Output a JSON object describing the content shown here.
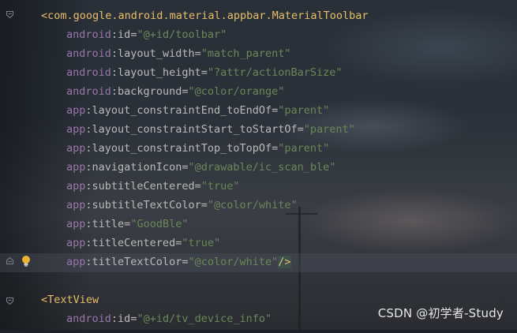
{
  "editor": {
    "lines": [
      {
        "type": "open",
        "tag": "com.google.android.material.appbar.MaterialToolbar"
      },
      {
        "type": "attr",
        "ns": "android",
        "name": "id",
        "value": "\"@+id/toolbar\""
      },
      {
        "type": "attr",
        "ns": "android",
        "name": "layout_width",
        "value": "\"match_parent\""
      },
      {
        "type": "attr",
        "ns": "android",
        "name": "layout_height",
        "value": "\"?attr/actionBarSize\""
      },
      {
        "type": "attr",
        "ns": "android",
        "name": "background",
        "value": "\"@color/orange\""
      },
      {
        "type": "attr",
        "ns": "app",
        "name": "layout_constraintEnd_toEndOf",
        "value": "\"parent\""
      },
      {
        "type": "attr",
        "ns": "app",
        "name": "layout_constraintStart_toStartOf",
        "value": "\"parent\""
      },
      {
        "type": "attr",
        "ns": "app",
        "name": "layout_constraintTop_toTopOf",
        "value": "\"parent\""
      },
      {
        "type": "attr",
        "ns": "app",
        "name": "navigationIcon",
        "value": "\"@drawable/ic_scan_ble\""
      },
      {
        "type": "attr",
        "ns": "app",
        "name": "subtitleCentered",
        "value": "\"true\""
      },
      {
        "type": "attr",
        "ns": "app",
        "name": "subtitleTextColor",
        "value": "\"@color/white\""
      },
      {
        "type": "attr",
        "ns": "app",
        "name": "title",
        "value": "\"GoodBle\""
      },
      {
        "type": "attr",
        "ns": "app",
        "name": "titleCentered",
        "value": "\"true\""
      },
      {
        "type": "attr",
        "ns": "app",
        "name": "titleTextColor",
        "value": "\"@color/white\"",
        "close": "/>"
      },
      {
        "type": "blank"
      },
      {
        "type": "open",
        "tag": "TextView"
      },
      {
        "type": "attr",
        "ns": "android",
        "name": "id",
        "value": "\"@+id/tv_device_info\""
      }
    ]
  },
  "watermark": "CSDN @初学者-Study",
  "colors": {
    "tag": "#e8bf6a",
    "namespace": "#9876aa",
    "attribute": "#bababa",
    "value": "#6a8759"
  }
}
